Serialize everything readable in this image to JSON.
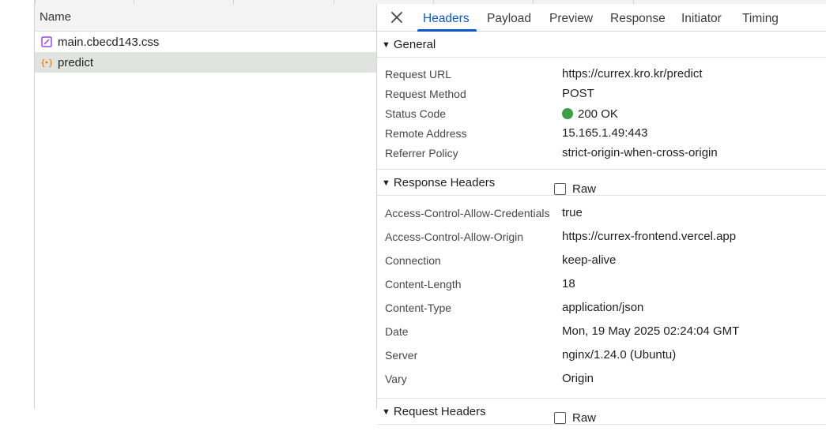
{
  "request_list": {
    "header": "Name",
    "items": [
      {
        "name": "main.cbecd143.css",
        "icon": "stylesheet-icon",
        "selected": false
      },
      {
        "name": "predict",
        "icon": "fetch-json-icon",
        "selected": true
      }
    ]
  },
  "tabs": [
    "Headers",
    "Payload",
    "Preview",
    "Response",
    "Initiator",
    "Timing"
  ],
  "active_tab": "Headers",
  "general": {
    "title": "General",
    "rows": [
      {
        "key": "Request URL",
        "value": "https://currex.kro.kr/predict"
      },
      {
        "key": "Request Method",
        "value": "POST"
      },
      {
        "key": "Status Code",
        "value": "200 OK"
      },
      {
        "key": "Remote Address",
        "value": "15.165.1.49:443"
      },
      {
        "key": "Referrer Policy",
        "value": "strict-origin-when-cross-origin"
      }
    ]
  },
  "response_headers": {
    "title": "Response Headers",
    "raw_label": "Raw",
    "rows": [
      {
        "key": "Access-Control-Allow-Credentials",
        "value": "true"
      },
      {
        "key": "Access-Control-Allow-Origin",
        "value": "https://currex-frontend.vercel.app"
      },
      {
        "key": "Connection",
        "value": "keep-alive"
      },
      {
        "key": "Content-Length",
        "value": "18"
      },
      {
        "key": "Content-Type",
        "value": "application/json"
      },
      {
        "key": "Date",
        "value": "Mon, 19 May 2025 02:24:04 GMT"
      },
      {
        "key": "Server",
        "value": "nginx/1.24.0 (Ubuntu)"
      },
      {
        "key": "Vary",
        "value": "Origin"
      }
    ]
  },
  "request_headers": {
    "title": "Request Headers",
    "raw_label": "Raw"
  },
  "colors": {
    "accent": "#0b57d0",
    "status_ok": "#3f9c48",
    "selected_row": "#e1e3e1",
    "css_icon": "#a142f4",
    "fetch_icon": "#e8710a"
  }
}
